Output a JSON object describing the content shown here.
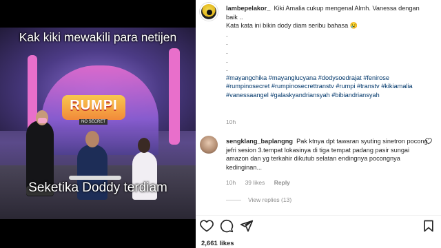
{
  "media": {
    "caption_top": "Kak kiki mewakili para netijen",
    "caption_bottom": "Seketika Doddy terdiam",
    "logo_text": "RUMPI",
    "logo_sub": "NO SECRET"
  },
  "post": {
    "author": "lambepelakor_",
    "caption_line1": "Kiki Amalia cukup mengenal Almh. Vanessa dengan baik ..",
    "caption_line2": "Kata kata ini bikin dody diam seribu bahasa 😢",
    "dots": [
      ".",
      ".",
      ".",
      ".",
      "."
    ],
    "hashtags": "#mayangchika #mayanglucyana #dodysoedrajat #fenirose #rumpinosecret #rumpinosecrettranstv #rumpi #transtv #kikiamalia #vanessaangel #galaskyandriansyah #bibiandriansyah",
    "time": "10h"
  },
  "comment": {
    "author": "sengklang_baplangng",
    "text": "Pak ktnya dpt tawaran syuting sinetron pocong jefri sesion 3.tempat lokasinya di tiga tempat padang pasir sungai amazon dan yg terkahir dikutub selatan endingnya pocongnya kedinginan...",
    "time": "10h",
    "likes": "39 likes",
    "reply_label": "Reply",
    "view_replies": "View replies (13)"
  },
  "actions": {
    "icons": [
      "heart-icon",
      "comment-icon",
      "share-icon",
      "save-icon"
    ]
  },
  "likes_count": "2,661 likes"
}
